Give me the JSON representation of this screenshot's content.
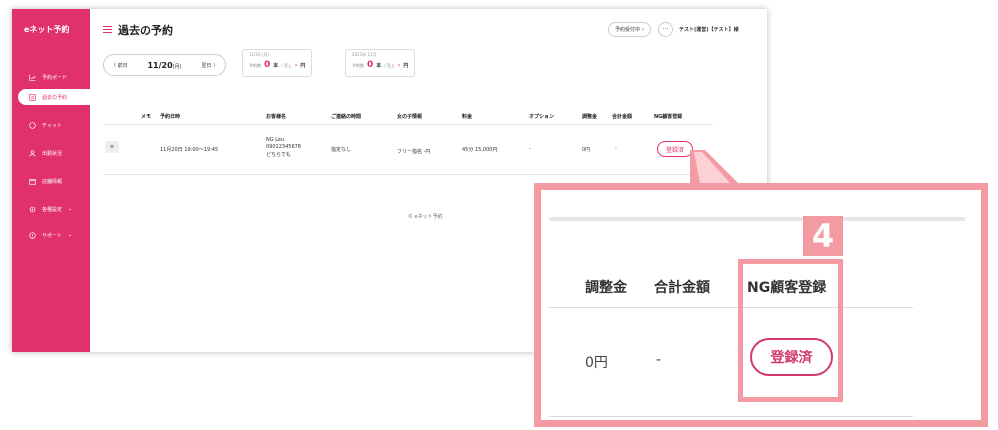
{
  "sidebar": {
    "logo": "eネット予約",
    "items": [
      {
        "label": "予約ボード",
        "icon": "chart-icon"
      },
      {
        "label": "過去の予約",
        "icon": "list-icon"
      },
      {
        "label": "チャット",
        "icon": "chat-icon"
      },
      {
        "label": "出勤状況",
        "icon": "person-icon"
      },
      {
        "label": "店舗情報",
        "icon": "store-icon"
      },
      {
        "label": "各種設定",
        "icon": "settings-icon"
      },
      {
        "label": "サポート",
        "icon": "help-icon"
      }
    ],
    "active_index": 1
  },
  "header": {
    "title": "過去の予約",
    "status_pill": "予約受付中",
    "more": "···",
    "user": "テスト(運営)【テスト】様"
  },
  "date_nav": {
    "prev": "〈 前日",
    "current": "11/20",
    "current_weekday": "(月)",
    "next": "翌日 〉"
  },
  "stats": [
    {
      "caption": "11/20 (月)",
      "count_label": "予約数",
      "count": "0",
      "count_unit": "本",
      "sales_label": "/ 売上",
      "sales": "-",
      "sales_unit": "円"
    },
    {
      "caption": "2023年 11月",
      "count_label": "予約数",
      "count": "0",
      "count_unit": "本",
      "sales_label": "/ 売上",
      "sales": "-",
      "sales_unit": "円"
    }
  ],
  "table": {
    "headers": {
      "memo": "メモ",
      "date": "予約日時",
      "customer": "お客様名",
      "contact": "ご連絡の時間",
      "girl": "女の子情報",
      "fee": "料金",
      "option": "オプション",
      "adjust": "調整金",
      "total": "合計金額",
      "ng": "NG顧客登録"
    },
    "rows": [
      {
        "memo": "≡",
        "date": "11月20日 19:00〜19:45",
        "customer_line1": "NG Leu",
        "customer_line2": "09012345678",
        "customer_line3": "どちらでも",
        "contact": "指定なし",
        "girl": "フリー指名 -円",
        "fee": "45分 15,000円",
        "option": "-",
        "adjust": "0円",
        "total": "-",
        "ng_button": "登録済"
      }
    ]
  },
  "footer": "© eネット予約",
  "zoom": {
    "step": "4",
    "headers": {
      "adjust": "調整金",
      "total": "合計金額",
      "ng": "NG顧客登録"
    },
    "values": {
      "adjust": "0円",
      "total": "-",
      "ng_button": "登録済"
    }
  },
  "colors": {
    "accent": "#e0306d",
    "callout": "#f49aa3"
  }
}
